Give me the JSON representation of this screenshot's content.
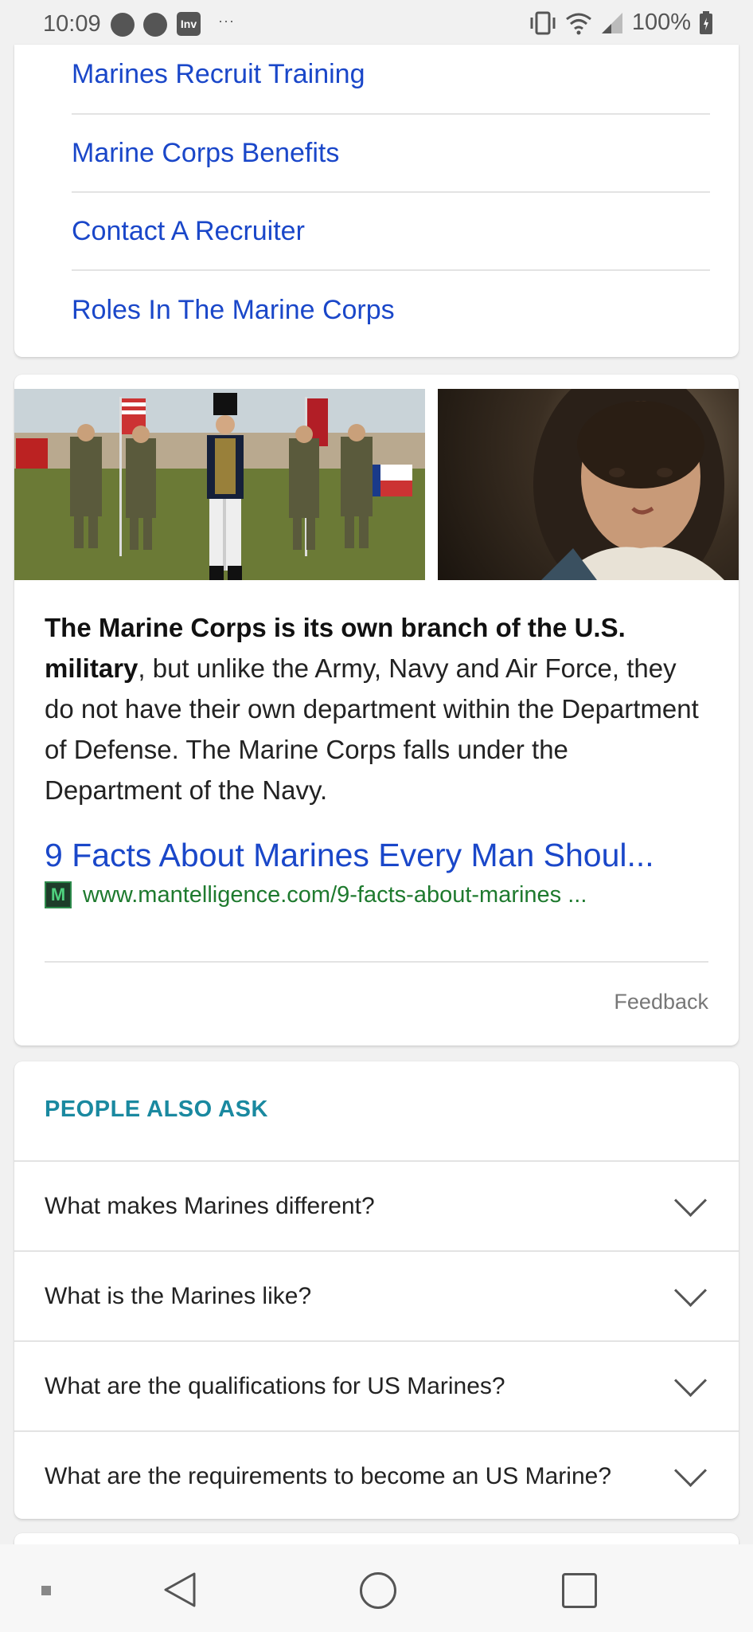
{
  "status_bar": {
    "time": "10:09",
    "notif_app_label": "Inv",
    "more": "···",
    "battery": "100%"
  },
  "links": [
    {
      "label": "Marines Recruit Training"
    },
    {
      "label": "Marine Corps Benefits"
    },
    {
      "label": "Contact A Recruiter"
    },
    {
      "label": "Roles In The Marine Corps"
    }
  ],
  "featured": {
    "snippet_bold": "The Marine Corps is its own branch of the U.S. military",
    "snippet_rest": ", but unlike the Army, Navy and Air Force, they do not have their own department within the Department of Defense. The Marine Corps falls under the Department of the Navy.",
    "result_title": "9 Facts About Marines Every Man Shoul...",
    "favicon_letter": "M",
    "result_url": "www.mantelligence.com/9-facts-about-marines ...",
    "feedback": "Feedback"
  },
  "people_also_ask": {
    "title": "PEOPLE ALSO ASK",
    "questions": [
      {
        "text": "What makes Marines different?"
      },
      {
        "text": "What is the Marines like?"
      },
      {
        "text": "What are the qualifications for US Marines?"
      },
      {
        "text": "What are the requirements to become an US Marine?"
      }
    ]
  },
  "colors": {
    "link": "#1a47c9",
    "url": "#1e7a2e",
    "paa_title": "#1a89a0"
  }
}
